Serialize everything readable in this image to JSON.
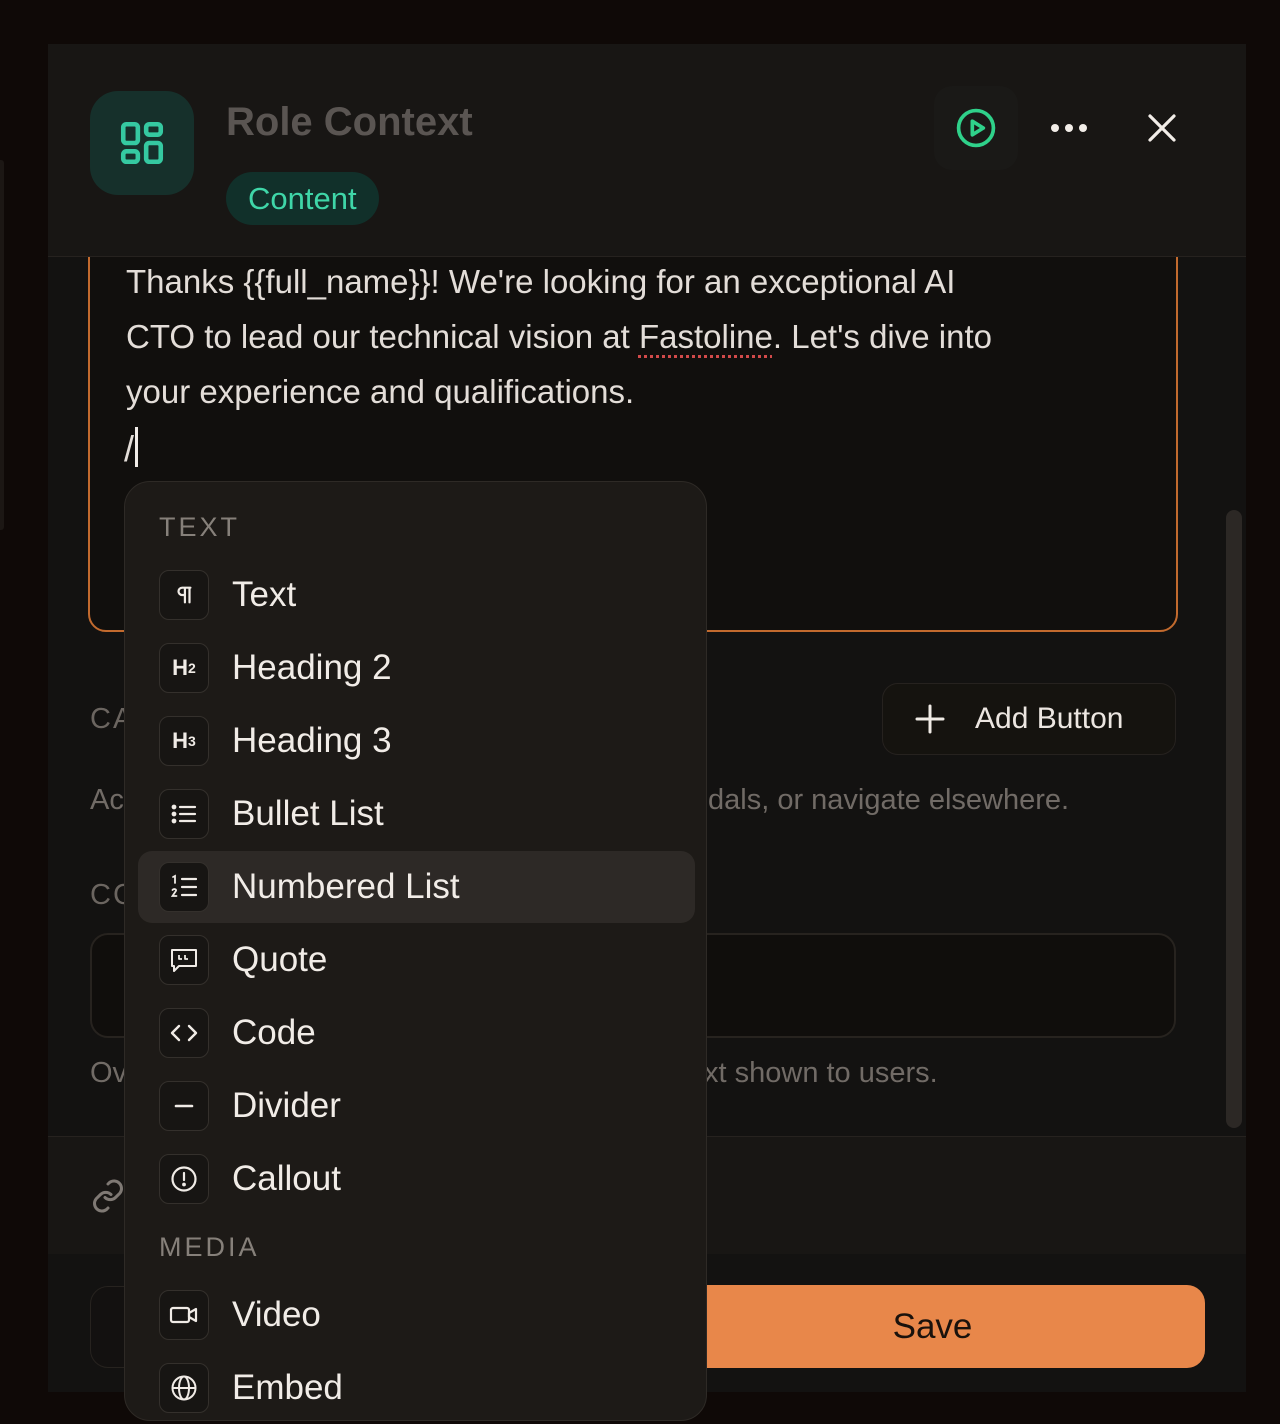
{
  "header": {
    "title": "Role Context",
    "badge": "Content",
    "icons": [
      "layout-grid-icon",
      "play-circle-icon",
      "more-horizontal-icon",
      "close-icon"
    ]
  },
  "editor": {
    "line1": "Thanks {{full_name}}! We're looking for an exceptional AI",
    "line2_before": "CTO to lead our technical vision at ",
    "line2_misspelled": "Fastoline",
    "line2_after": ". Let's dive into",
    "line3": "your experience and qualifications.",
    "slash_input": "/"
  },
  "form": {
    "cta_label_partial": "CA",
    "cta_helper_start": "Ac",
    "cta_helper_end": "dals, or navigate elsewhere.",
    "add_button": "Add Button",
    "content_label_partial": "CC",
    "override_helper_start": "Ov",
    "override_helper_end": "xt shown to users."
  },
  "footer": {
    "save": "Save"
  },
  "slash_menu": {
    "groups": {
      "text": "TEXT",
      "media": "MEDIA"
    },
    "items": [
      {
        "label": "Text",
        "icon": "pilcrow-icon"
      },
      {
        "label": "Heading 2",
        "icon": "heading-2-icon"
      },
      {
        "label": "Heading 3",
        "icon": "heading-3-icon"
      },
      {
        "label": "Bullet List",
        "icon": "bullet-list-icon"
      },
      {
        "label": "Numbered List",
        "icon": "numbered-list-icon",
        "highlighted": true
      },
      {
        "label": "Quote",
        "icon": "quote-icon"
      },
      {
        "label": "Code",
        "icon": "code-icon"
      },
      {
        "label": "Divider",
        "icon": "divider-icon"
      },
      {
        "label": "Callout",
        "icon": "callout-icon"
      },
      {
        "label": "Video",
        "icon": "video-icon"
      },
      {
        "label": "Embed",
        "icon": "globe-icon"
      }
    ]
  },
  "colors": {
    "accent_orange": "#e8874a",
    "accent_teal": "#3fd6a8",
    "background": "#0f0907"
  }
}
